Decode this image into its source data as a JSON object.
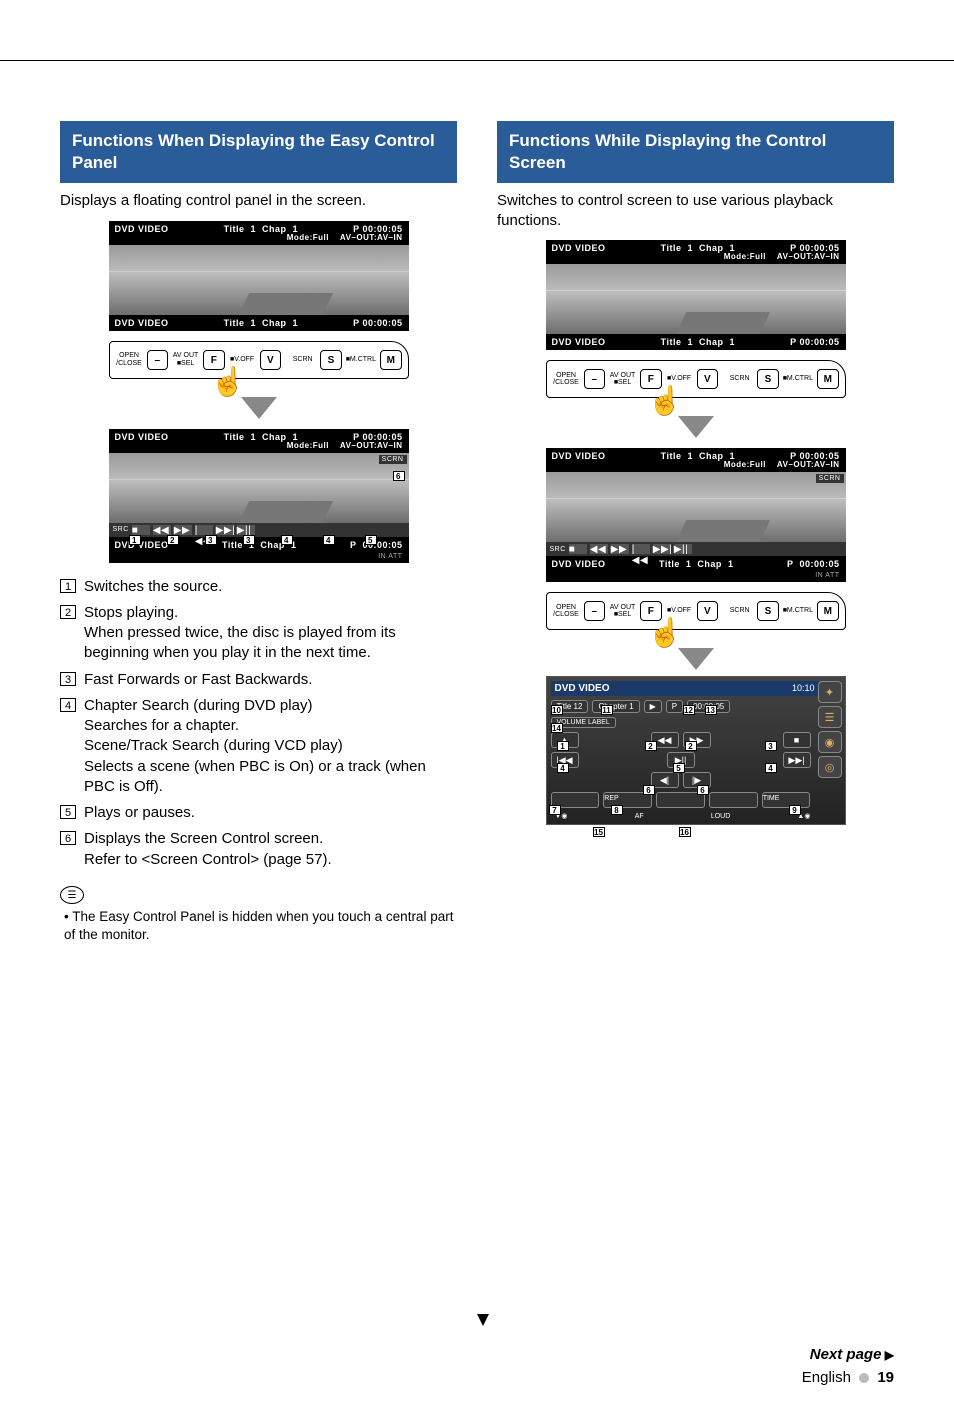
{
  "left": {
    "heading": "Functions When Displaying the Easy Control Panel",
    "intro": "Displays a floating control panel in the screen.",
    "screen": {
      "source": "DVD VIDEO",
      "title_label": "Title",
      "title_num": "1",
      "chap_label": "Chap",
      "chap_num": "1",
      "play_time": "P  00:00:05",
      "mode": "Mode:Full",
      "av": "AV–OUT:AV–IN"
    },
    "panel": {
      "open": "OPEN /CLOSE",
      "avout": "AV OUT ■SEL",
      "voff": "■V.OFF",
      "scrn": "SCRN",
      "mctrl": "■M.CTRL",
      "btn_minus": "–",
      "btn_f": "F",
      "btn_v": "V",
      "btn_s": "S",
      "btn_m": "M"
    },
    "screen2_footer": {
      "src": "SRC",
      "in_att": "IN      ATT"
    },
    "list": {
      "i1": "Switches the source.",
      "i2a": "Stops playing.",
      "i2b": "When pressed twice, the disc is played from its beginning when you play it in the next time.",
      "i3": "Fast Forwards or Fast Backwards.",
      "i4a": "Chapter Search (during DVD play)",
      "i4b": "Searches for a chapter.",
      "i4c": "Scene/Track Search (during VCD play)",
      "i4d": "Selects a scene (when PBC is On) or a track (when PBC is Off).",
      "i5": "Plays or pauses.",
      "i6a": "Displays the Screen Control screen.",
      "i6b": "Refer to <Screen Control> (page 57)."
    },
    "note": "The Easy Control Panel is hidden when you touch a central part of the monitor."
  },
  "right": {
    "heading": "Functions While Displaying the Control Screen",
    "intro": "Switches to control screen to use various playback functions.",
    "ctrl": {
      "header": "DVD VIDEO",
      "clock": "10:10",
      "title": "Title 12",
      "chapter": "Chapter    1",
      "play_icon": "▶",
      "p_label": "P",
      "time": "00:00:05",
      "volume_label": "VOLUME LABEL",
      "rep": "REP",
      "time_btn": "TIME",
      "af": "AF",
      "loud": "LOUD"
    }
  },
  "callouts": {
    "n1": "1",
    "n2": "2",
    "n3": "3",
    "n4": "4",
    "n5": "5",
    "n6": "6",
    "n7": "7",
    "n8": "8",
    "n9": "9",
    "n10": "10",
    "n11": "11",
    "n12": "12",
    "n13": "13",
    "n14": "14",
    "n15": "15",
    "n16": "16"
  },
  "footer": {
    "next": "Next page",
    "lang": "English",
    "page": "19"
  }
}
